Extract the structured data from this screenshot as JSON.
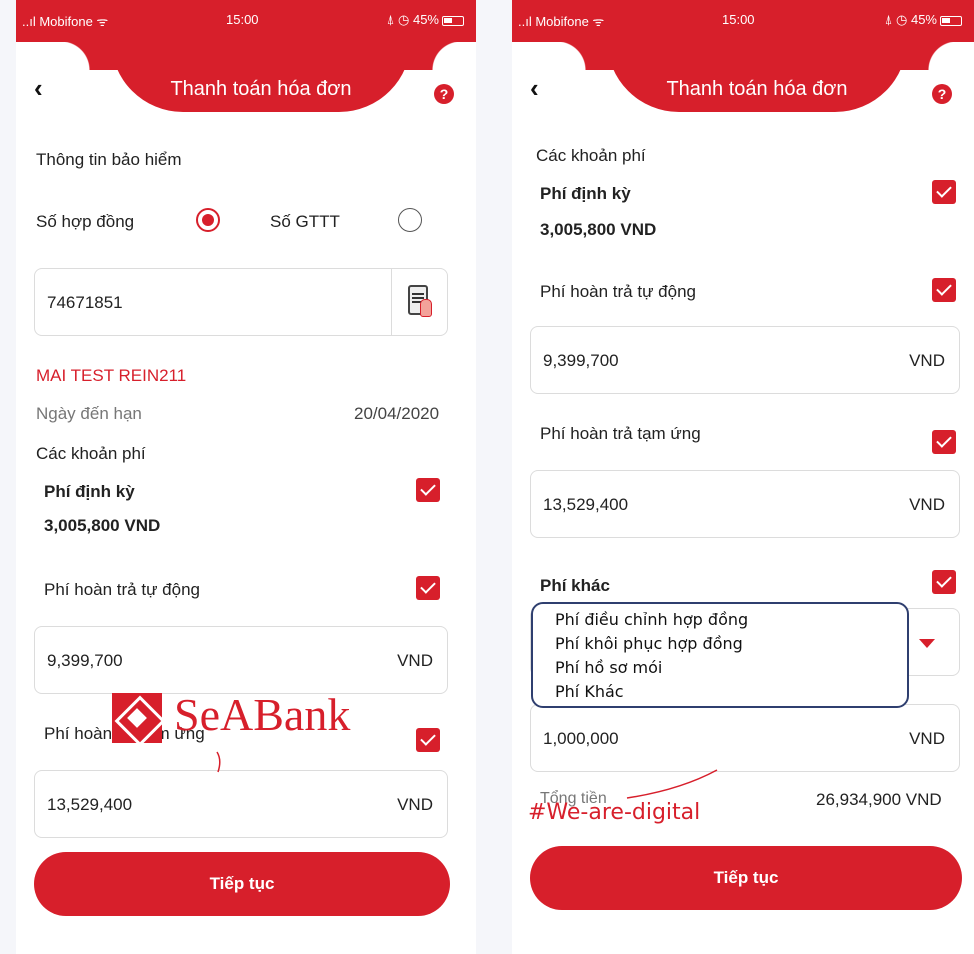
{
  "status_bar": {
    "left": {
      "carrier": "..ıl Mobifone ᯤ",
      "time": "15:00",
      "right": "⍋ ◷ 45%"
    },
    "right": {
      "carrier": "..ıl Mobifone ᯤ",
      "time": "15:00",
      "right": "⍋ ◷ 45%"
    }
  },
  "header": {
    "title": "Thanh toán hóa đơn",
    "back": "‹",
    "help": "?"
  },
  "left": {
    "section_title": "Thông tin bảo hiểm",
    "radio_contract": "Số hợp đồng",
    "radio_gttt": "Số GTTT",
    "contract_number": "74671851",
    "customer_name": "MAI TEST REIN211",
    "due_date_label": "Ngày đến hạn",
    "due_date_value": "20/04/2020",
    "fees_label": "Các khoản phí",
    "periodic_fee_label": "Phí định kỳ",
    "periodic_fee_value": "3,005,800 VND",
    "auto_refund_label": "Phí hoàn trả tự động",
    "auto_refund_value": "9,399,700",
    "advance_refund_label": "Phí hoàn trả tạm ứng",
    "advance_refund_value": "13,529,400",
    "currency": "VND",
    "continue_button": "Tiếp tục"
  },
  "brand": {
    "name": "SeABank"
  },
  "right": {
    "fees_label": "Các khoản phí",
    "periodic_fee_label": "Phí định kỳ",
    "periodic_fee_value": "3,005,800 VND",
    "auto_refund_label": "Phí hoàn trả tự động",
    "auto_refund_value": "9,399,700",
    "advance_refund_label": "Phí hoàn trả tạm ứng",
    "advance_refund_value": "13,529,400",
    "other_fee_label": "Phí khác",
    "other_fee_options": [
      "Phí điều chỉnh hợp đồng",
      "Phí khôi phục hợp đồng",
      "Phí hồ sơ mói",
      "Phí Khác"
    ],
    "other_fee_value": "1,000,000",
    "total_label": "Tổng tiền",
    "total_value": "26,934,900 VND",
    "currency": "VND",
    "continue_button": "Tiếp tục"
  },
  "hashtag": "#We-are-digital",
  "colors": {
    "brand_red": "#d71f2b",
    "dropdown_border": "#2f3f6f"
  }
}
